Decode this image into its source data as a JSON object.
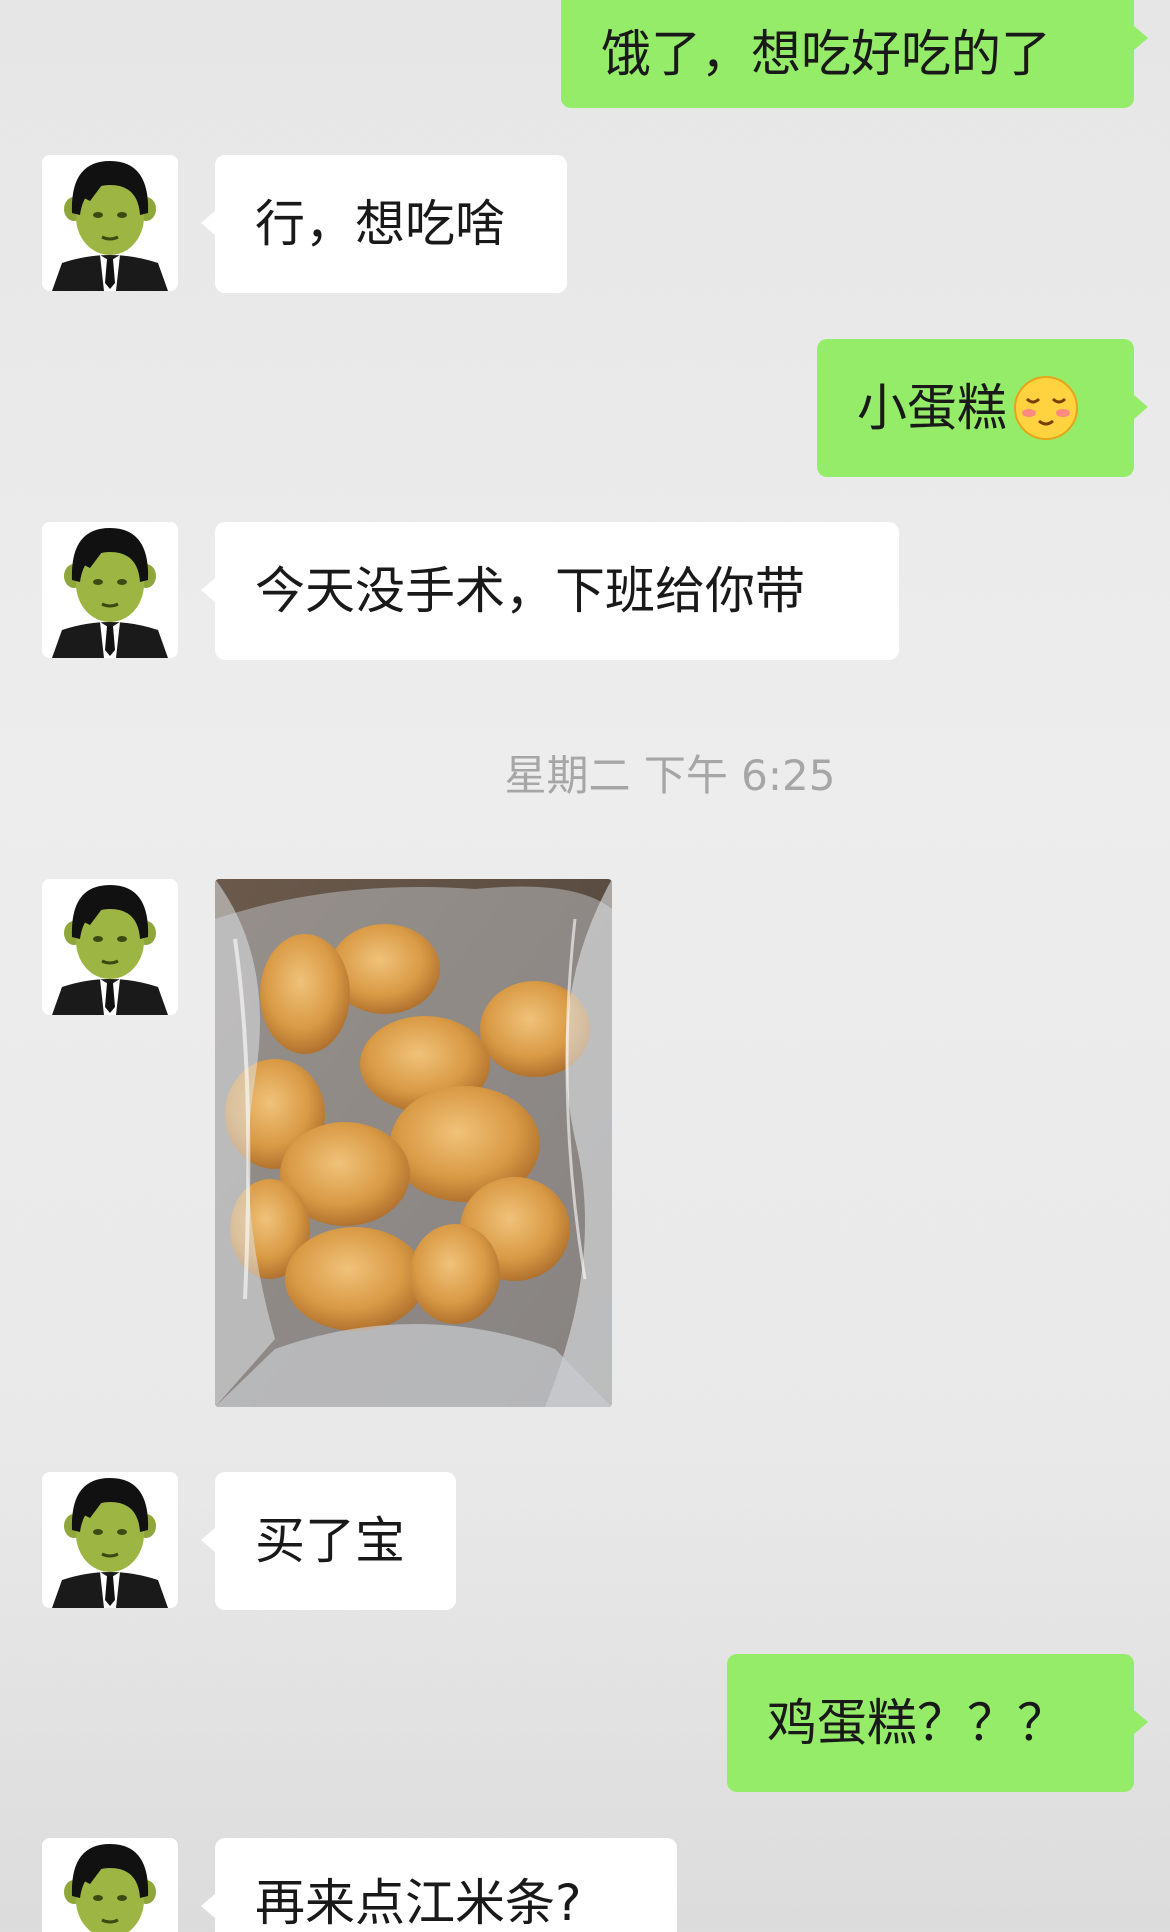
{
  "chat": {
    "timestamp": "星期二 下午 6:25",
    "messages": [
      {
        "sender": "me",
        "text": "饿了，想吃好吃的了"
      },
      {
        "sender": "other",
        "text": "行，想吃啥"
      },
      {
        "sender": "me",
        "text": "小蛋糕",
        "emoji": "shy-smile-emoji"
      },
      {
        "sender": "other",
        "text": "今天没手术，下班给你带"
      },
      {
        "sender": "other",
        "type": "image",
        "image_subject": "cakes-in-plastic-bag-photo"
      },
      {
        "sender": "other",
        "text": "买了宝"
      },
      {
        "sender": "me",
        "text": "鸡蛋糕？？？"
      },
      {
        "sender": "other",
        "text": "再来点江米条?"
      }
    ]
  },
  "colors": {
    "outgoing_bubble": "#95ec69",
    "incoming_bubble": "#ffffff",
    "background": "#ededed",
    "timestamp_text": "#a6a6a6"
  }
}
